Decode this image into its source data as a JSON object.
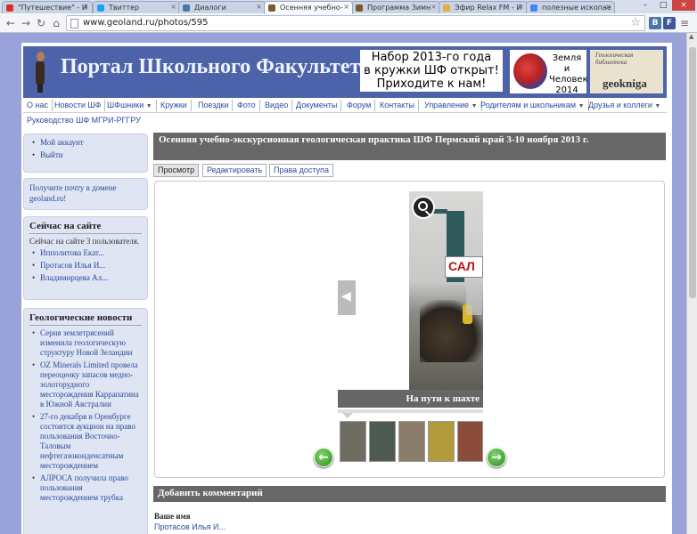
{
  "browser": {
    "tabs": [
      {
        "label": "\"Путешествие\" - И",
        "color": "#d93025"
      },
      {
        "label": "Твиттер",
        "color": "#1da1f2"
      },
      {
        "label": "Диалоги",
        "color": "#4a76a8"
      },
      {
        "label": "Осенняя учебно-",
        "color": "#7a5a2a"
      },
      {
        "label": "Программа Зимн",
        "color": "#7a5a2a"
      },
      {
        "label": "Эфир Relax FM - И",
        "color": "#e7b03a"
      },
      {
        "label": "полезные ископае",
        "color": "#4285f4"
      }
    ],
    "active_tab": 3,
    "url": "www.geoland.ru/photos/595",
    "window_controls": [
      "–",
      "□",
      "×"
    ],
    "extensions": [
      {
        "glyph": "В",
        "color": "#4a76a8"
      },
      {
        "glyph": "F",
        "color": "#3b5998"
      }
    ]
  },
  "site": {
    "title": "Портал Школьного Факультета",
    "announcement": [
      "Набор 2013-го года",
      "в кружки ШФ открыт!",
      "Приходите к нам!"
    ],
    "logo_earth": [
      "Земля",
      "и",
      "Человек",
      "2014"
    ],
    "logo_geokniga": "geokniga",
    "logo_geokniga_arc": "Геологическая библиотека"
  },
  "menu": {
    "row1": [
      {
        "label": "О нас",
        "caret": false
      },
      {
        "label": "Новости ШФ",
        "caret": false
      },
      {
        "label": "ШФшники",
        "caret": true
      },
      {
        "label": "Кружки",
        "caret": false
      },
      {
        "label": "Поездки",
        "caret": false
      },
      {
        "label": "Фото",
        "caret": false
      },
      {
        "label": "Видео",
        "caret": false
      },
      {
        "label": "Документы",
        "caret": false
      },
      {
        "label": "Форум",
        "caret": false
      },
      {
        "label": "Контакты",
        "caret": false
      },
      {
        "label": "Управление",
        "caret": true
      },
      {
        "label": "Родителям и школьникам",
        "caret": true
      },
      {
        "label": "Друзья и коллеги",
        "caret": true
      }
    ],
    "row2": {
      "label": "Руководство ШФ МГРИ-РГГРУ"
    }
  },
  "sidebar": {
    "account_links": [
      "Мой аккаунт",
      "Выйти"
    ],
    "mail_promo": "Получите почту в домене geoland.ru!",
    "online": {
      "title": "Сейчас на сайте",
      "summary": "Сейчас на сайте 3 пользователя.",
      "users": [
        "Ипполитова Екат...",
        "Протасов Илья И...",
        "Владимирцева Ал..."
      ]
    },
    "geo_news": {
      "title": "Геологические новости",
      "items": [
        "Серия землетрясений изменила геологическую структуру Новой Зеландии",
        "OZ Minerals Limited провела переоценку запасов медно-золоторудного месторождения Каррапатина в Южной Австралии",
        "27-го декабря в Оренбурге состоится аукцион на право пользования Восточно-Таловым нефтегазоконденсатным месторождением",
        "АЛРОСА получила право пользования месторождением трубка"
      ]
    }
  },
  "main": {
    "title": "Осенняя учебно-экскурсионная геологическая практика ШФ Пермский край 3-10 ноября 2013 г.",
    "tabs": [
      "Просмотр",
      "Редактировать",
      "Права доступа"
    ],
    "active_tab": 0,
    "gallery": {
      "caption": "На пути к шахте",
      "sign_text": "САЛ",
      "thumb_colors": [
        "#6f6c62",
        "#4d5a52",
        "#8a7e6a",
        "#b39a3a",
        "#8c4c3c"
      ]
    },
    "comment_title": "Добавить комментарий",
    "name_label": "Ваше имя",
    "name_value": "Протасов Илья И..."
  }
}
